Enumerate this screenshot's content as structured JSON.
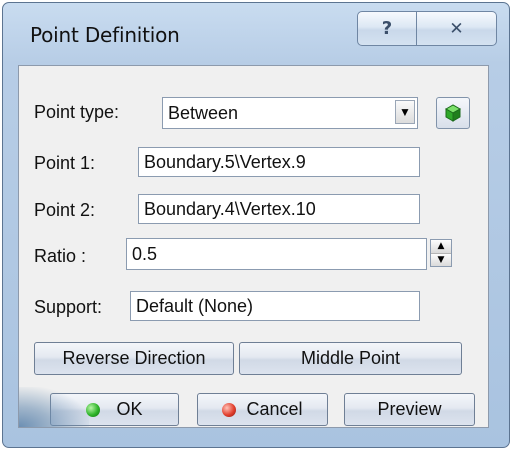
{
  "window": {
    "title": "Point Definition",
    "help_glyph": "?",
    "close_glyph": "✕"
  },
  "form": {
    "point_type_label": "Point type:",
    "point_type_value": "Between",
    "point1_label": "Point 1:",
    "point1_value": "Boundary.5\\Vertex.9",
    "point2_label": "Point 2:",
    "point2_value": "Boundary.4\\Vertex.10",
    "ratio_label": "Ratio :",
    "ratio_value": "0.5",
    "support_label": "Support:",
    "support_value": "Default (None)"
  },
  "buttons": {
    "reverse_direction": "Reverse Direction",
    "middle_point": "Middle Point",
    "ok": "OK",
    "cancel": "Cancel",
    "preview": "Preview"
  },
  "icons": {
    "point_type_lock": "green-cube-icon",
    "ok": "green-ball-icon",
    "cancel": "red-ball-icon"
  }
}
